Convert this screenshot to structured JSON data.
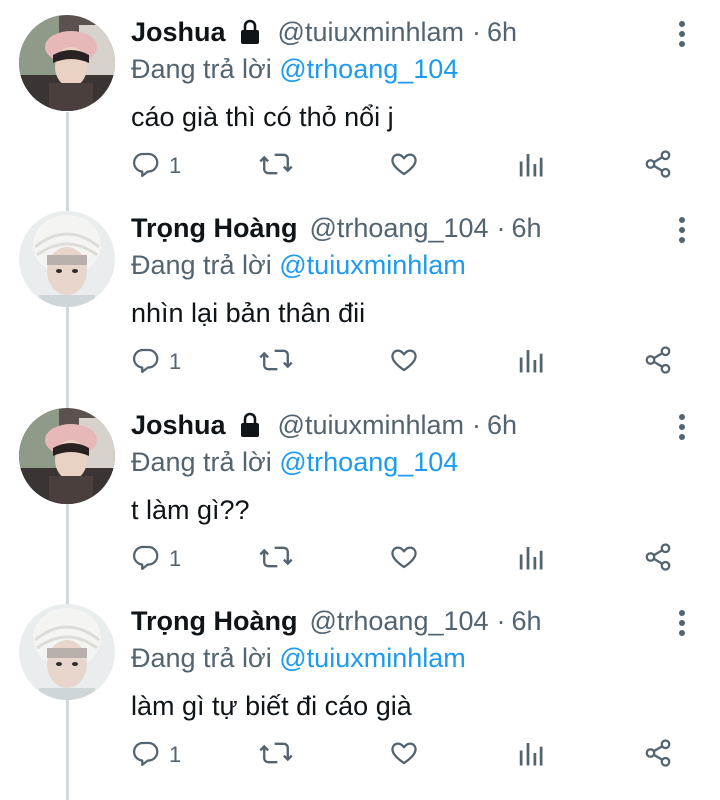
{
  "tweets": [
    {
      "name": "Joshua",
      "verified_lock": true,
      "handle": "@tuiuxminhlam",
      "dot": "·",
      "time": "6h",
      "reply_prefix": "Đang trả lời ",
      "reply_to": "@trhoang_104",
      "text": "cáo già thì có thỏ nổi j",
      "reply_count": "1",
      "avatar": "joshua"
    },
    {
      "name": "Trọng Hoàng",
      "verified_lock": false,
      "handle": "@trhoang_104",
      "dot": "·",
      "time": "6h",
      "reply_prefix": "Đang trả lời ",
      "reply_to": "@tuiuxminhlam",
      "text": "nhìn lại bản thân đii",
      "reply_count": "1",
      "avatar": "trong"
    },
    {
      "name": "Joshua",
      "verified_lock": true,
      "handle": "@tuiuxminhlam",
      "dot": "·",
      "time": "6h",
      "reply_prefix": "Đang trả lời ",
      "reply_to": "@trhoang_104",
      "text": "t làm gì??",
      "reply_count": "1",
      "avatar": "joshua"
    },
    {
      "name": "Trọng Hoàng",
      "verified_lock": false,
      "handle": "@trhoang_104",
      "dot": "·",
      "time": "6h",
      "reply_prefix": "Đang trả lời ",
      "reply_to": "@tuiuxminhlam",
      "text": "làm gì tự biết đi cáo già",
      "reply_count": "1",
      "avatar": "trong"
    }
  ],
  "icons": {
    "reply": "reply-icon",
    "retweet": "retweet-icon",
    "like": "heart-icon",
    "views": "analytics-icon",
    "share": "share-icon",
    "more": "more-vertical-icon",
    "lock": "lock-icon"
  },
  "colors": {
    "text": "#0f1419",
    "secondary": "#536471",
    "mention": "#1d9bf0",
    "thread_line": "#cfd9de"
  }
}
